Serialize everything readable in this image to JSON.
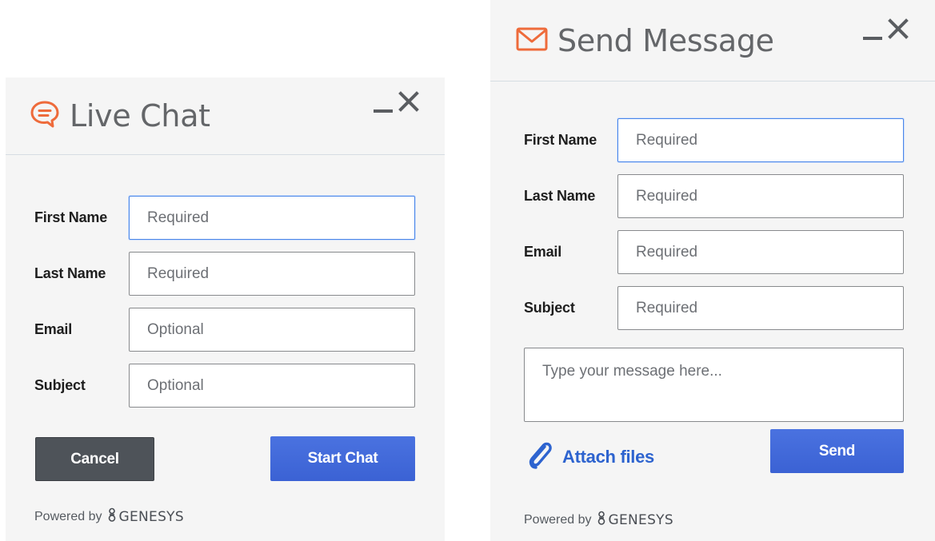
{
  "live_chat": {
    "title": "Live Chat",
    "fields": [
      {
        "label": "First Name",
        "placeholder": "Required"
      },
      {
        "label": "Last Name",
        "placeholder": "Required"
      },
      {
        "label": "Email",
        "placeholder": "Optional"
      },
      {
        "label": "Subject",
        "placeholder": "Optional"
      }
    ],
    "cancel_label": "Cancel",
    "start_label": "Start Chat",
    "powered_by": "Powered by",
    "brand": "GENESYS"
  },
  "send_message": {
    "title": "Send Message",
    "fields": [
      {
        "label": "First Name",
        "placeholder": "Required"
      },
      {
        "label": "Last Name",
        "placeholder": "Required"
      },
      {
        "label": "Email",
        "placeholder": "Required"
      },
      {
        "label": "Subject",
        "placeholder": "Required"
      }
    ],
    "message_placeholder": "Type your message here...",
    "attach_label": "Attach files",
    "send_label": "Send",
    "powered_by": "Powered by",
    "brand": "GENESYS"
  },
  "colors": {
    "accent_orange": "#ee6b3b",
    "primary_blue": "#3e66d8",
    "focus_blue": "#4a86e8",
    "cancel_gray": "#4e5359"
  }
}
